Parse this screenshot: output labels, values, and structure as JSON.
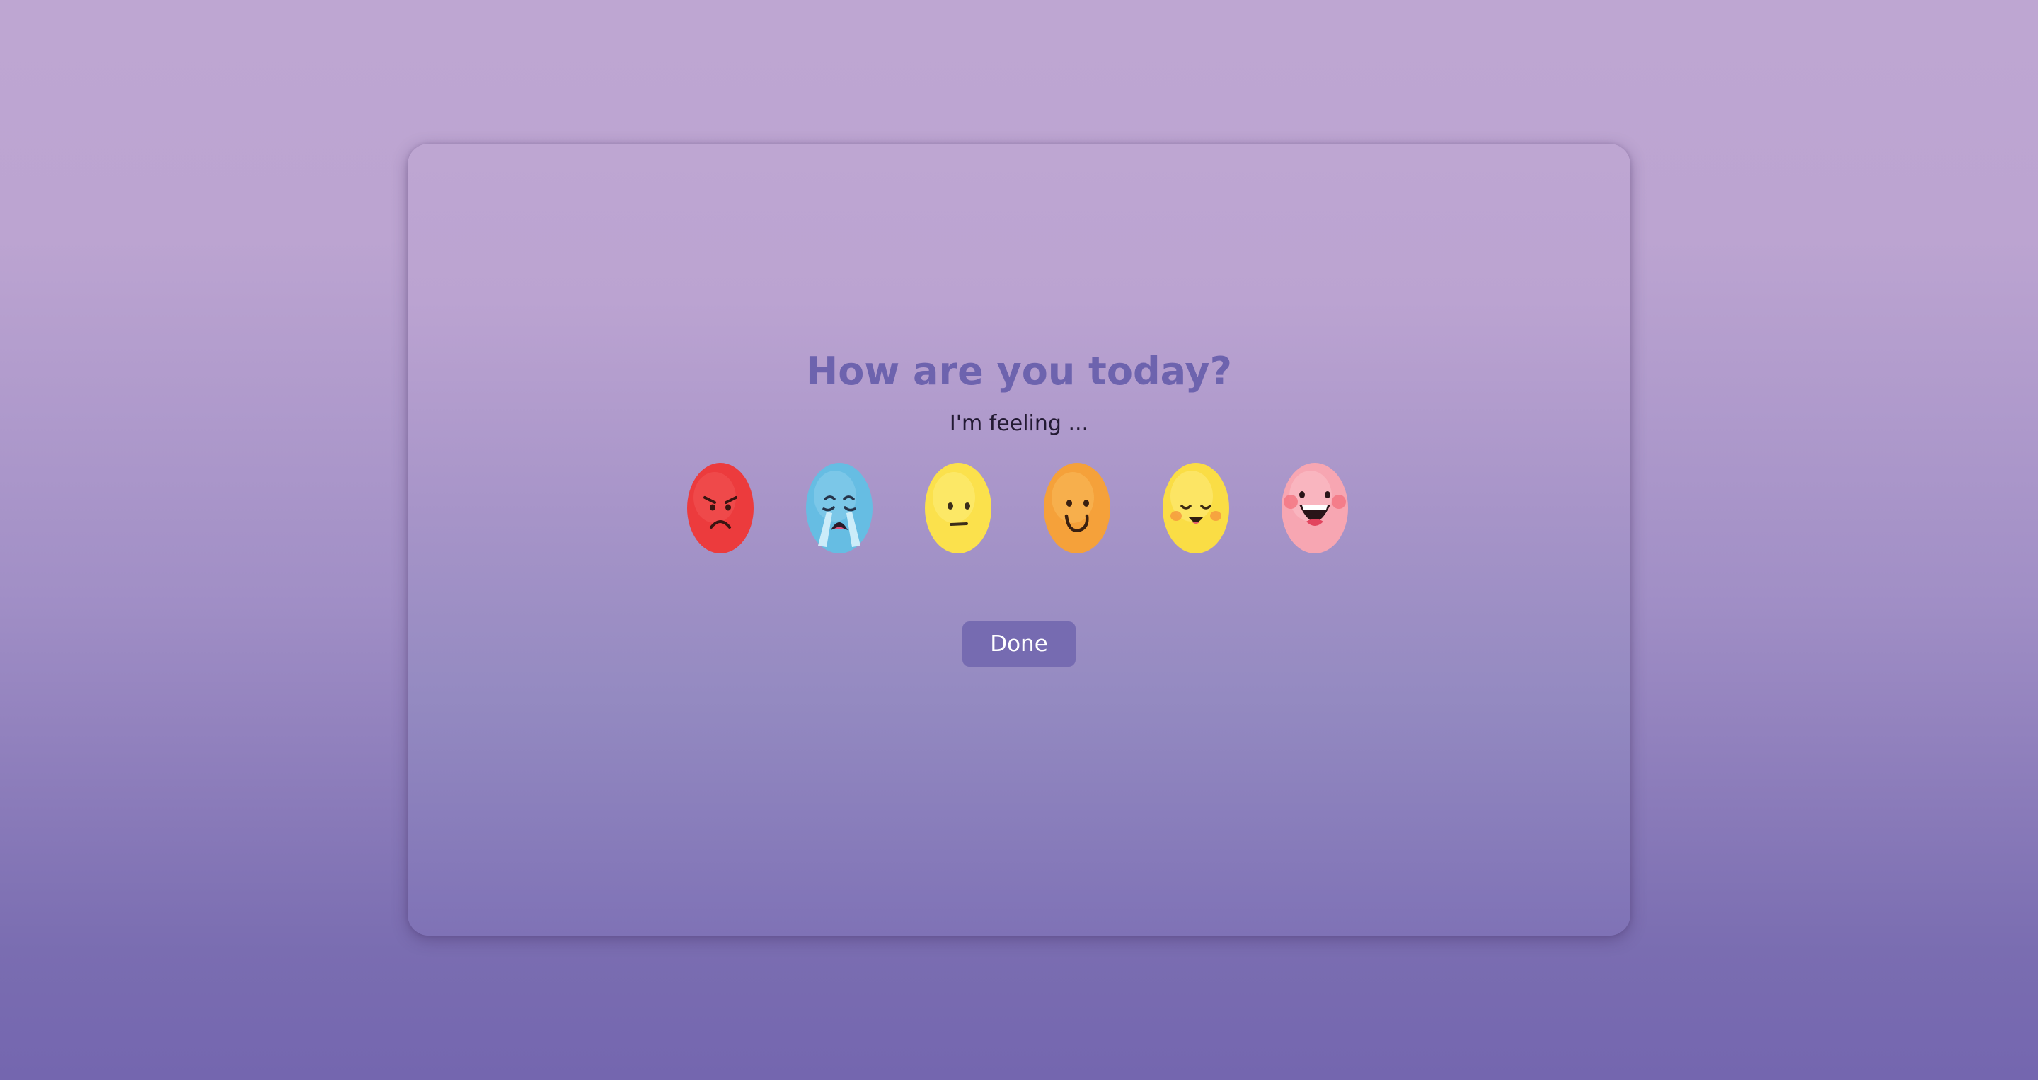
{
  "question": {
    "title": "How are you today?",
    "subtitle": "I'm feeling ..."
  },
  "moods": [
    {
      "icon": "angry-face-icon",
      "color": "#ee3f3f"
    },
    {
      "icon": "crying-face-icon",
      "color": "#6fc3e6"
    },
    {
      "icon": "neutral-face-icon",
      "color": "#fbe34f"
    },
    {
      "icon": "smiling-face-icon",
      "color": "#f6a23b"
    },
    {
      "icon": "content-face-icon",
      "color": "#fadf4c"
    },
    {
      "icon": "laughing-face-icon",
      "color": "#f7a9b4"
    }
  ],
  "actions": {
    "done_label": "Done"
  },
  "colors": {
    "accent": "#766bb1",
    "title": "#6d63ae"
  }
}
